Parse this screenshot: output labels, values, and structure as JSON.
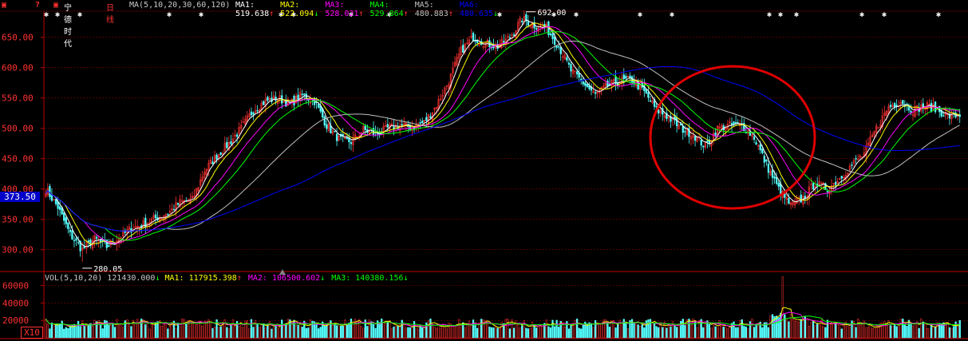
{
  "header": {
    "stock_name": "宁德时代",
    "period": "日线",
    "ma_params": "MA(5,10,20,30,60,120)",
    "items": [
      {
        "label": "MA1:",
        "value": "519.638",
        "arrow": "↑",
        "color": "#ffffff"
      },
      {
        "label": "MA2:",
        "value": "522.094",
        "arrow": "↓",
        "color": "#ffff00"
      },
      {
        "label": "MA3:",
        "value": "528.021",
        "arrow": "↑",
        "color": "#ff00ff"
      },
      {
        "label": "MA4:",
        "value": "529.864",
        "arrow": "↑",
        "color": "#00ff00"
      },
      {
        "label": "MA5:",
        "value": "480.883",
        "arrow": "↑",
        "color": "#c0c0c0"
      },
      {
        "label": "MA6:",
        "value": "480.635",
        "arrow": "↓",
        "color": "#0000ff"
      }
    ]
  },
  "volume_header": {
    "label": "VOL(5,10,20)",
    "value": "121430.000",
    "arrow": "↓",
    "items": [
      {
        "label": "MA1:",
        "value": "117915.398",
        "arrow": "↑",
        "color": "#ffff00"
      },
      {
        "label": "MA2:",
        "value": "106500.602",
        "arrow": "↓",
        "color": "#ff00ff"
      },
      {
        "label": "MA3:",
        "value": "140380.156",
        "arrow": "↓",
        "color": "#00ff00"
      }
    ]
  },
  "current_price": "373.50",
  "volume_unit": "X10",
  "annotations": {
    "high": "692.00",
    "low": "280.05"
  },
  "colors": {
    "up": "#ff3232",
    "down": "#54ffff",
    "grid": "#800000",
    "axis": "#c00000",
    "label": "#ff3232",
    "circle": "#e00000"
  },
  "chart_data": [
    {
      "type": "candlestick",
      "title": "宁德时代 日线",
      "yticks": [
        "650.00",
        "600.00",
        "550.00",
        "500.00",
        "450.00",
        "400.00",
        "350.00",
        "300.00"
      ],
      "ylim": [
        268,
        693
      ],
      "close_path": [
        [
          0,
          400
        ],
        [
          6,
          370
        ],
        [
          12,
          325
        ],
        [
          18,
          300
        ],
        [
          24,
          318
        ],
        [
          30,
          305
        ],
        [
          36,
          320
        ],
        [
          42,
          335
        ],
        [
          48,
          342
        ],
        [
          54,
          352
        ],
        [
          60,
          360
        ],
        [
          66,
          378
        ],
        [
          72,
          382
        ],
        [
          78,
          430
        ],
        [
          84,
          455
        ],
        [
          90,
          475
        ],
        [
          96,
          500
        ],
        [
          102,
          530
        ],
        [
          108,
          545
        ],
        [
          114,
          550
        ],
        [
          120,
          540
        ],
        [
          126,
          555
        ],
        [
          132,
          545
        ],
        [
          138,
          505
        ],
        [
          144,
          482
        ],
        [
          150,
          478
        ],
        [
          156,
          498
        ],
        [
          162,
          490
        ],
        [
          168,
          500
        ],
        [
          174,
          505
        ],
        [
          180,
          502
        ],
        [
          186,
          510
        ],
        [
          192,
          538
        ],
        [
          198,
          578
        ],
        [
          204,
          628
        ],
        [
          210,
          650
        ],
        [
          216,
          640
        ],
        [
          222,
          635
        ],
        [
          228,
          650
        ],
        [
          234,
          680
        ],
        [
          240,
          670
        ],
        [
          246,
          665
        ],
        [
          252,
          635
        ],
        [
          258,
          595
        ],
        [
          264,
          575
        ],
        [
          270,
          555
        ],
        [
          276,
          570
        ],
        [
          282,
          578
        ],
        [
          288,
          580
        ],
        [
          294,
          560
        ],
        [
          300,
          530
        ],
        [
          306,
          518
        ],
        [
          312,
          500
        ],
        [
          318,
          490
        ],
        [
          324,
          470
        ],
        [
          330,
          500
        ],
        [
          336,
          505
        ],
        [
          342,
          505
        ],
        [
          348,
          485
        ],
        [
          354,
          440
        ],
        [
          360,
          400
        ],
        [
          366,
          372
        ],
        [
          372,
          385
        ],
        [
          378,
          410
        ],
        [
          384,
          400
        ],
        [
          390,
          418
        ],
        [
          396,
          440
        ],
        [
          402,
          458
        ],
        [
          408,
          500
        ],
        [
          414,
          535
        ],
        [
          420,
          545
        ],
        [
          426,
          530
        ],
        [
          432,
          538
        ],
        [
          438,
          530
        ],
        [
          444,
          520
        ],
        [
          449,
          522
        ]
      ],
      "n_bars": 450,
      "series": [
        {
          "name": "MA1",
          "period": 5
        },
        {
          "name": "MA2",
          "period": 10
        },
        {
          "name": "MA3",
          "period": 20
        },
        {
          "name": "MA4",
          "period": 30
        },
        {
          "name": "MA5",
          "period": 60
        },
        {
          "name": "MA6",
          "period": 120
        }
      ],
      "last_values": {
        "MA1": 519.638,
        "MA2": 522.094,
        "MA3": 528.021,
        "MA4": 529.864,
        "MA5": 480.883,
        "MA6": 480.635
      }
    },
    {
      "type": "bar",
      "title": "VOL(5,10,20)",
      "yticks": [
        "60000",
        "40000",
        "20000"
      ],
      "ylim": [
        0,
        65000
      ],
      "spike_bar_index": 362,
      "spike_value": 62000,
      "last_value": 121430.0,
      "series": [
        {
          "name": "MA1",
          "period": 5
        },
        {
          "name": "MA2",
          "period": 10
        },
        {
          "name": "MA3",
          "period": 20
        }
      ]
    }
  ]
}
